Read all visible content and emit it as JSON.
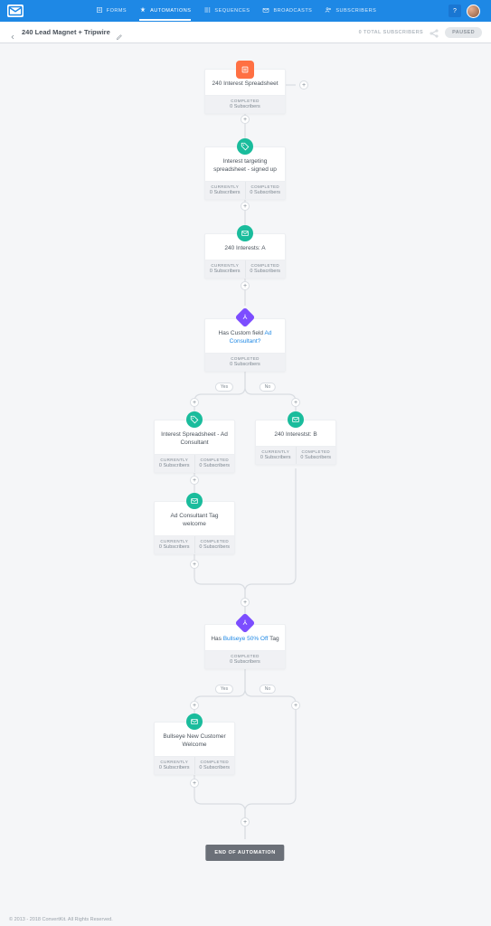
{
  "nav": {
    "items": [
      {
        "label": "FORMS",
        "icon": "forms"
      },
      {
        "label": "AUTOMATIONS",
        "icon": "automations",
        "active": true
      },
      {
        "label": "SEQUENCES",
        "icon": "sequences"
      },
      {
        "label": "BROADCASTS",
        "icon": "broadcasts"
      },
      {
        "label": "SUBSCRIBERS",
        "icon": "subscribers"
      }
    ],
    "help": "?"
  },
  "subheader": {
    "title": "240 Lead Magnet + Tripwire",
    "total": "0 TOTAL SUBSCRIBERS",
    "pause": "PAUSED"
  },
  "stats": {
    "currently_label": "CURRENTLY",
    "completed_label": "COMPLETED",
    "zero_subs": "0 Subscribers"
  },
  "nodes": {
    "n1": {
      "title": "240 Interest Spreadsheet"
    },
    "n2": {
      "title": "Interest targeting spreadsheet - signed up"
    },
    "n3": {
      "title": "240 Interests: A"
    },
    "n4": {
      "prefix": "Has Custom field ",
      "link": "Ad Consultant?"
    },
    "n5": {
      "title": "Interest Spreadsheet - Ad Consultant"
    },
    "n6": {
      "title": "240 Interestst: B"
    },
    "n7": {
      "title": "Ad Consultant Tag welcome"
    },
    "n8": {
      "prefix": "Has ",
      "link": "Bullseye 50% Off",
      "suffix": " Tag"
    },
    "n9": {
      "title": "Bullseye New Customer Welcome"
    }
  },
  "labels": {
    "yes": "Yes",
    "no": "No",
    "end": "END OF AUTOMATION"
  },
  "footer": "© 2013 - 2018 ConvertKit. All Rights Reserved."
}
